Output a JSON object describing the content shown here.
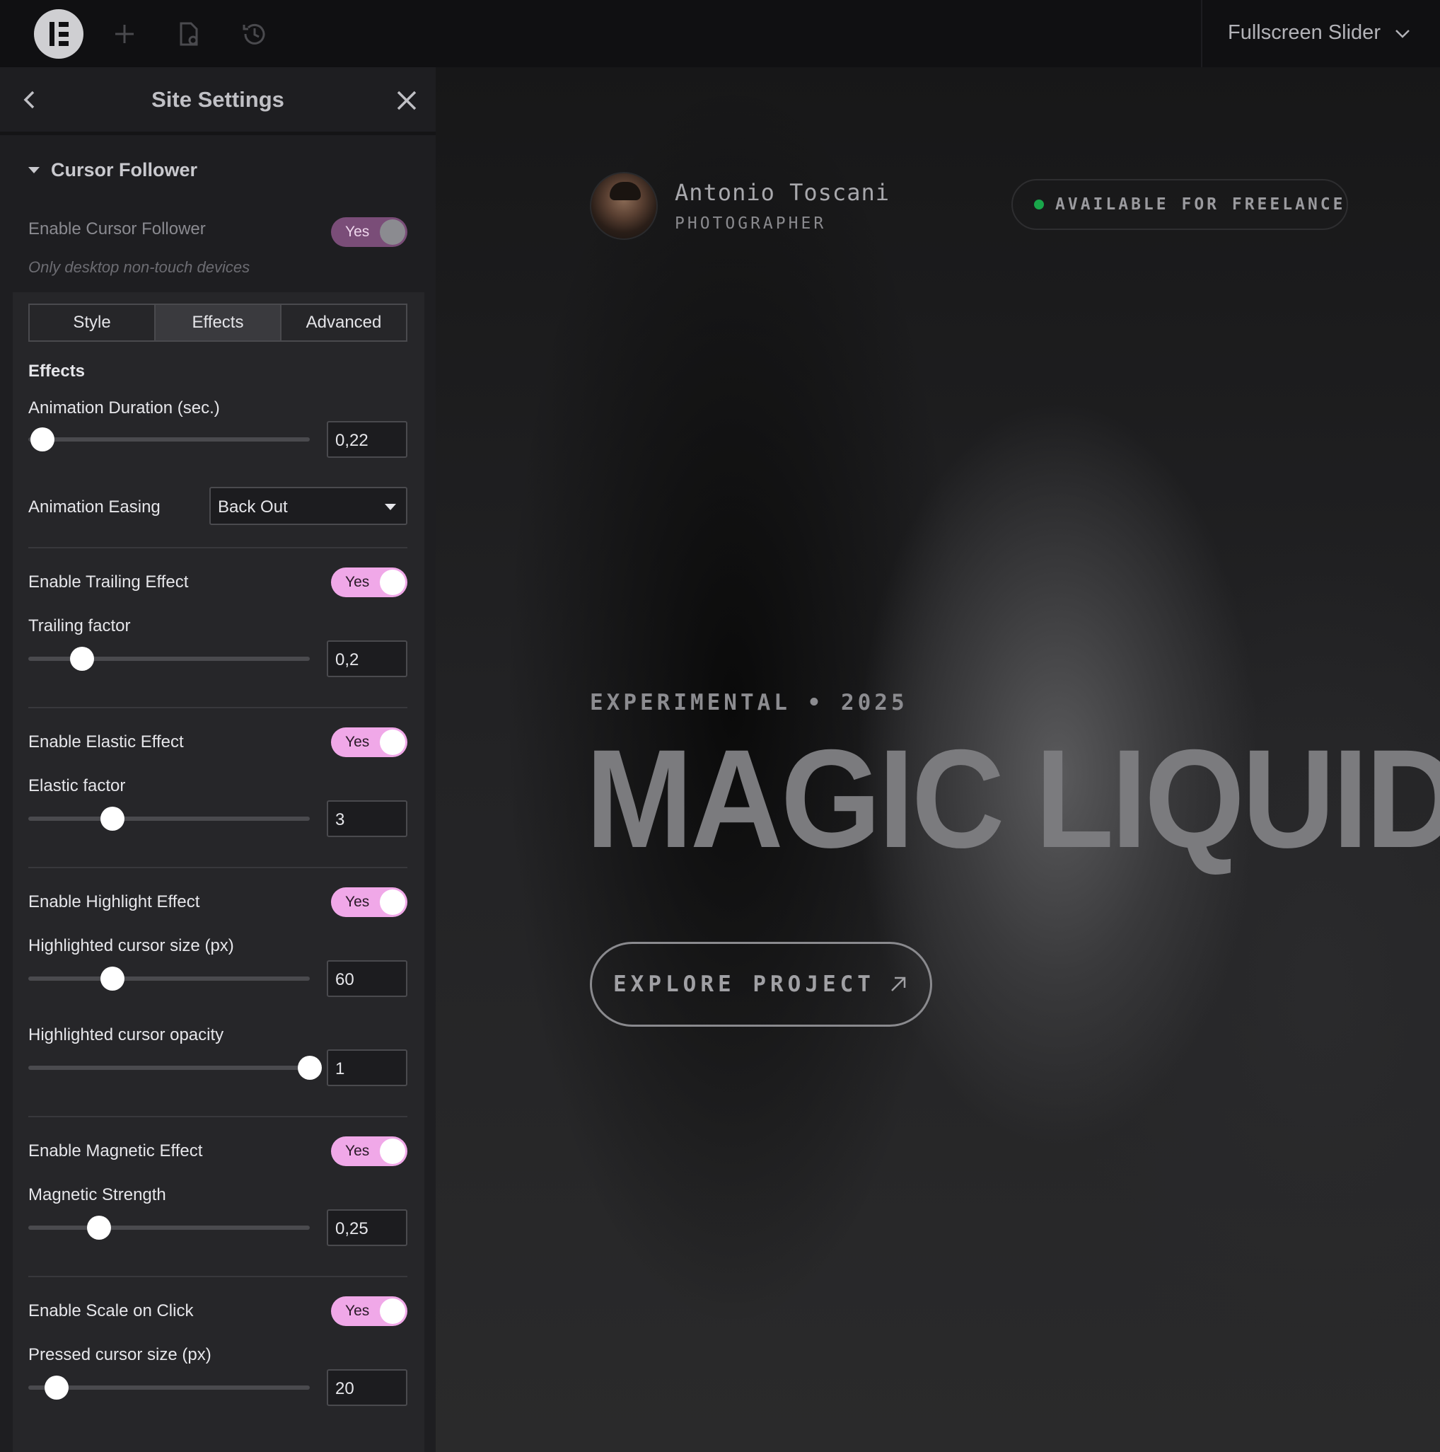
{
  "topbar": {
    "page_selector": "Fullscreen Slider",
    "icons": [
      "elementor-logo-icon",
      "add-icon",
      "page-settings-icon",
      "history-icon",
      "chevron-down-icon"
    ]
  },
  "panel": {
    "title": "Site Settings",
    "section_title": "Cursor Follower",
    "enable_label": "Enable Cursor Follower",
    "enable_value": "Yes",
    "hint": "Only desktop non-touch devices",
    "tabs": [
      {
        "label": "Style",
        "active": false
      },
      {
        "label": "Effects",
        "active": true
      },
      {
        "label": "Advanced",
        "active": false
      }
    ],
    "group_heading": "Effects",
    "animation_duration": {
      "label": "Animation Duration (sec.)",
      "value": "0,22",
      "slider_fraction": 0.05
    },
    "animation_easing": {
      "label": "Animation Easing",
      "value": "Back Out"
    },
    "trailing": {
      "toggle_label": "Enable Trailing Effect",
      "toggle_value": "Yes",
      "factor_label": "Trailing factor",
      "value": "0,2",
      "slider_fraction": 0.19
    },
    "elastic": {
      "toggle_label": "Enable Elastic Effect",
      "toggle_value": "Yes",
      "factor_label": "Elastic factor",
      "value": "3",
      "slider_fraction": 0.3
    },
    "highlight": {
      "toggle_label": "Enable Highlight Effect",
      "toggle_value": "Yes",
      "size_label": "Highlighted cursor size (px)",
      "size_value": "60",
      "size_fraction": 0.3,
      "opacity_label": "Highlighted cursor opacity",
      "opacity_value": "1",
      "opacity_fraction": 1.0
    },
    "magnetic": {
      "toggle_label": "Enable Magnetic Effect",
      "toggle_value": "Yes",
      "strength_label": "Magnetic Strength",
      "value": "0,25",
      "slider_fraction": 0.25
    },
    "scale_click": {
      "toggle_label": "Enable Scale on Click",
      "toggle_value": "Yes",
      "size_label": "Pressed cursor size (px)",
      "value": "20",
      "slider_fraction": 0.1
    }
  },
  "preview": {
    "name": "Antonio Toscani",
    "role": "PHOTOGRAPHER",
    "badge": "AVAILABLE FOR FREELANCE",
    "eyebrow": "EXPERIMENTAL • 2025",
    "headline": "MAGIC LIQUID",
    "cta": "EXPLORE PROJECT",
    "colors": {
      "accent_toggle": "#f0a8e8",
      "status_dot": "#19a64a"
    }
  }
}
